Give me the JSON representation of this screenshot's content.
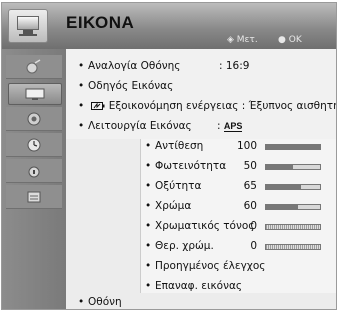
{
  "header": {
    "title": "ΕΙΚΟΝΑ",
    "hint_move_glyph": "◈",
    "hint_move": "Μετ.",
    "hint_ok_glyph": "●",
    "hint_ok": "OK"
  },
  "sidebar": {
    "items": [
      {
        "icon": "signal-icon"
      },
      {
        "icon": "picture-icon",
        "active": true
      },
      {
        "icon": "audio-icon"
      },
      {
        "icon": "clock-icon"
      },
      {
        "icon": "lock-icon"
      },
      {
        "icon": "options-icon"
      }
    ]
  },
  "menu": {
    "aspect_label": "Αναλογία Οθόνης",
    "aspect_value": ": 16:9",
    "wizard_label": "Οδηγός Εικόνας",
    "energy_label": "Εξοικονόμηση ενέργειας : Έξυπνος αισθητήρας",
    "mode_label": "Λειτουργία Εικόνας",
    "mode_value_prefix": ":",
    "mode_value_logo": "APS",
    "screen_label": "Οθόνη"
  },
  "picture_settings": [
    {
      "label": "Αντίθεση",
      "value": "100",
      "level": 1.0,
      "style": "solid"
    },
    {
      "label": "Φωτεινότητα",
      "value": "50",
      "level": 0.5,
      "style": "solid"
    },
    {
      "label": "Οξύτητα",
      "value": "65",
      "level": 0.65,
      "style": "solid"
    },
    {
      "label": "Χρώμα",
      "value": "60",
      "level": 0.6,
      "style": "solid"
    },
    {
      "label": "Χρωματικός τόνος",
      "value": "0",
      "level": 0.5,
      "style": "hatched"
    },
    {
      "label": "Θερ. χρώμ.",
      "value": "0",
      "level": 0.5,
      "style": "hatched"
    }
  ],
  "advanced": {
    "advanced_label": "Προηγμένος έλεγχος",
    "reset_label": "Επαναφ. εικόνας"
  }
}
